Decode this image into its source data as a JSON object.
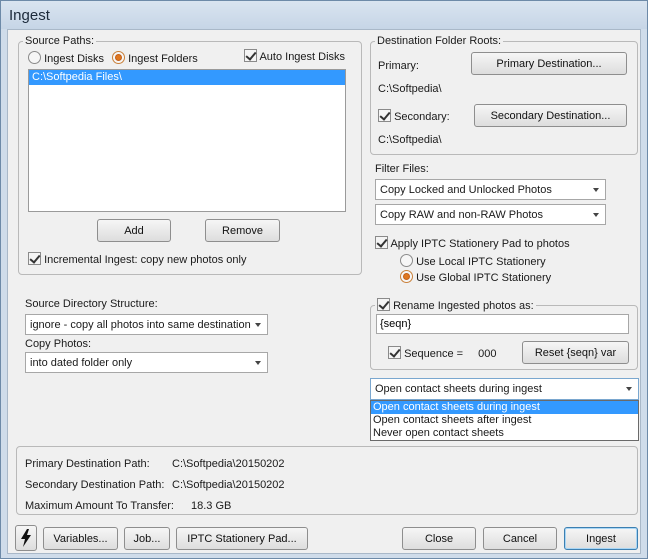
{
  "window": {
    "title": "Ingest"
  },
  "source": {
    "legend": "Source Paths:",
    "ingest_disks_label": "Ingest Disks",
    "ingest_folders_label": "Ingest Folders",
    "auto_ingest_label": "Auto Ingest Disks",
    "paths": [
      "C:\\Softpedia Files\\"
    ],
    "add_label": "Add",
    "remove_label": "Remove",
    "incremental_label": "Incremental Ingest: copy new photos only"
  },
  "structure": {
    "label": "Source Directory Structure:",
    "value": "ignore - copy all photos into same destination",
    "copy_label": "Copy Photos:",
    "copy_value": "into dated folder only"
  },
  "destination": {
    "legend": "Destination Folder Roots:",
    "primary_label": "Primary:",
    "primary_button": "Primary Destination...",
    "primary_path": "C:\\Softpedia\\",
    "secondary_label": "Secondary:",
    "secondary_button": "Secondary Destination...",
    "secondary_path": "C:\\Softpedia\\"
  },
  "filter": {
    "label": "Filter Files:",
    "locked_value": "Copy Locked and Unlocked Photos",
    "raw_value": "Copy RAW and non-RAW Photos",
    "iptc_label": "Apply IPTC Stationery Pad to photos",
    "local_label": "Use Local IPTC Stationery",
    "global_label": "Use Global IPTC Stationery"
  },
  "rename": {
    "label": "Rename Ingested photos as:",
    "value": "{seqn}",
    "sequence_label": "Sequence =",
    "sequence_value": "000",
    "reset_label": "Reset {seqn} var"
  },
  "contact": {
    "value": "Open contact sheets during ingest",
    "options": [
      "Open contact sheets during ingest",
      "Open contact sheets after ingest",
      "Never open contact sheets"
    ]
  },
  "summary": {
    "primary_path_label": "Primary Destination Path:",
    "primary_path_value": "C:\\Softpedia\\20150202",
    "secondary_path_label": "Secondary Destination Path:",
    "secondary_path_value": "C:\\Softpedia\\20150202",
    "max_label": "Maximum Amount To Transfer:",
    "max_value": "18.3 GB"
  },
  "footer": {
    "variables_label": "Variables...",
    "job_label": "Job...",
    "iptc_pad_label": "IPTC Stationery Pad...",
    "close_label": "Close",
    "cancel_label": "Cancel",
    "ingest_label": "Ingest"
  },
  "icons": {
    "lightning": "lightning-icon"
  },
  "colors": {
    "selection": "#3399ff",
    "radio_accent": "#e0771f"
  }
}
